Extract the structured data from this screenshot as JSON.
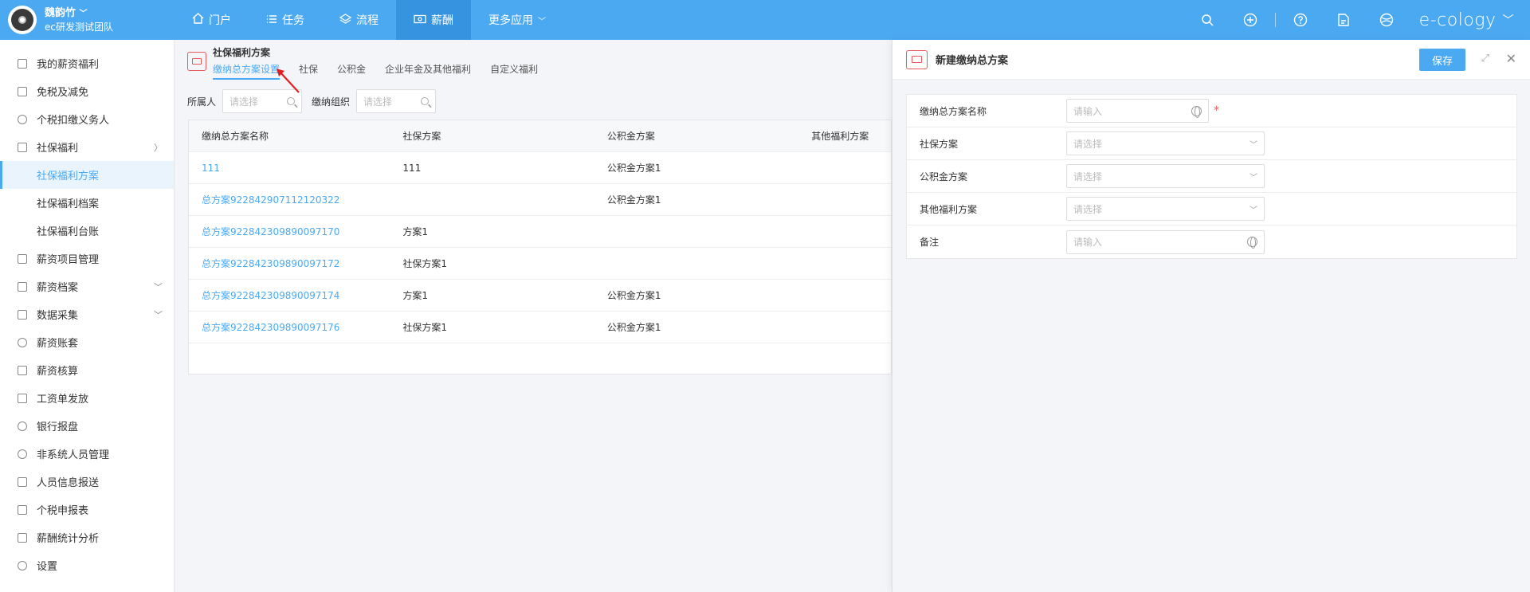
{
  "user": {
    "name": "魏韵竹",
    "team": "ec研发测试团队"
  },
  "nav": [
    {
      "label": "门户",
      "icon": "home-icon"
    },
    {
      "label": "任务",
      "icon": "list-icon"
    },
    {
      "label": "流程",
      "icon": "layers-icon"
    },
    {
      "label": "薪酬",
      "icon": "money-icon",
      "active": true
    },
    {
      "label": "更多应用",
      "icon": "chevron-down-icon"
    }
  ],
  "brand": "e-cology",
  "sidebar": {
    "items": [
      {
        "label": "我的薪资福利"
      },
      {
        "label": "免税及减免"
      },
      {
        "label": "个税扣缴义务人"
      },
      {
        "label": "社保福利"
      },
      {
        "label": "社保福利方案"
      },
      {
        "label": "社保福利档案"
      },
      {
        "label": "社保福利台账"
      },
      {
        "label": "薪资项目管理"
      },
      {
        "label": "薪资档案"
      },
      {
        "label": "数据采集"
      },
      {
        "label": "薪资账套"
      },
      {
        "label": "薪资核算"
      },
      {
        "label": "工资单发放"
      },
      {
        "label": "银行报盘"
      },
      {
        "label": "非系统人员管理"
      },
      {
        "label": "人员信息报送"
      },
      {
        "label": "个税申报表"
      },
      {
        "label": "薪酬统计分析"
      },
      {
        "label": "设置"
      }
    ]
  },
  "main": {
    "title": "社保福利方案",
    "tabs": [
      {
        "label": "缴纳总方案设置"
      },
      {
        "label": "社保"
      },
      {
        "label": "公积金"
      },
      {
        "label": "企业年金及其他福利"
      },
      {
        "label": "自定义福利"
      }
    ],
    "filters": {
      "owner_label": "所属人",
      "owner_placeholder": "请选择",
      "org_label": "缴纳组织",
      "org_placeholder": "请选择"
    },
    "table": {
      "headers": [
        "缴纳总方案名称",
        "社保方案",
        "公积金方案",
        "其他福利方案"
      ],
      "rows": [
        [
          "111",
          "111",
          "公积金方案1",
          ""
        ],
        [
          "总方案922842907112120322",
          "",
          "公积金方案1",
          ""
        ],
        [
          "总方案922842309890097170",
          "方案1",
          "",
          ""
        ],
        [
          "总方案922842309890097172",
          "社保方案1",
          "",
          ""
        ],
        [
          "总方案922842309890097174",
          "方案1",
          "公积金方案1",
          ""
        ],
        [
          "总方案922842309890097176",
          "社保方案1",
          "公积金方案1",
          ""
        ]
      ]
    }
  },
  "panel": {
    "title": "新建缴纳总方案",
    "save_label": "保存",
    "fields": [
      {
        "label": "缴纳总方案名称",
        "placeholder": "请输入",
        "type": "text",
        "required": true
      },
      {
        "label": "社保方案",
        "placeholder": "请选择",
        "type": "select"
      },
      {
        "label": "公积金方案",
        "placeholder": "请选择",
        "type": "select"
      },
      {
        "label": "其他福利方案",
        "placeholder": "请选择",
        "type": "select"
      },
      {
        "label": "备注",
        "placeholder": "请输入",
        "type": "text"
      }
    ]
  },
  "colors": {
    "accent": "#4ba9f2",
    "topbar": "#4ba9f2",
    "required": "#e85a5a"
  }
}
